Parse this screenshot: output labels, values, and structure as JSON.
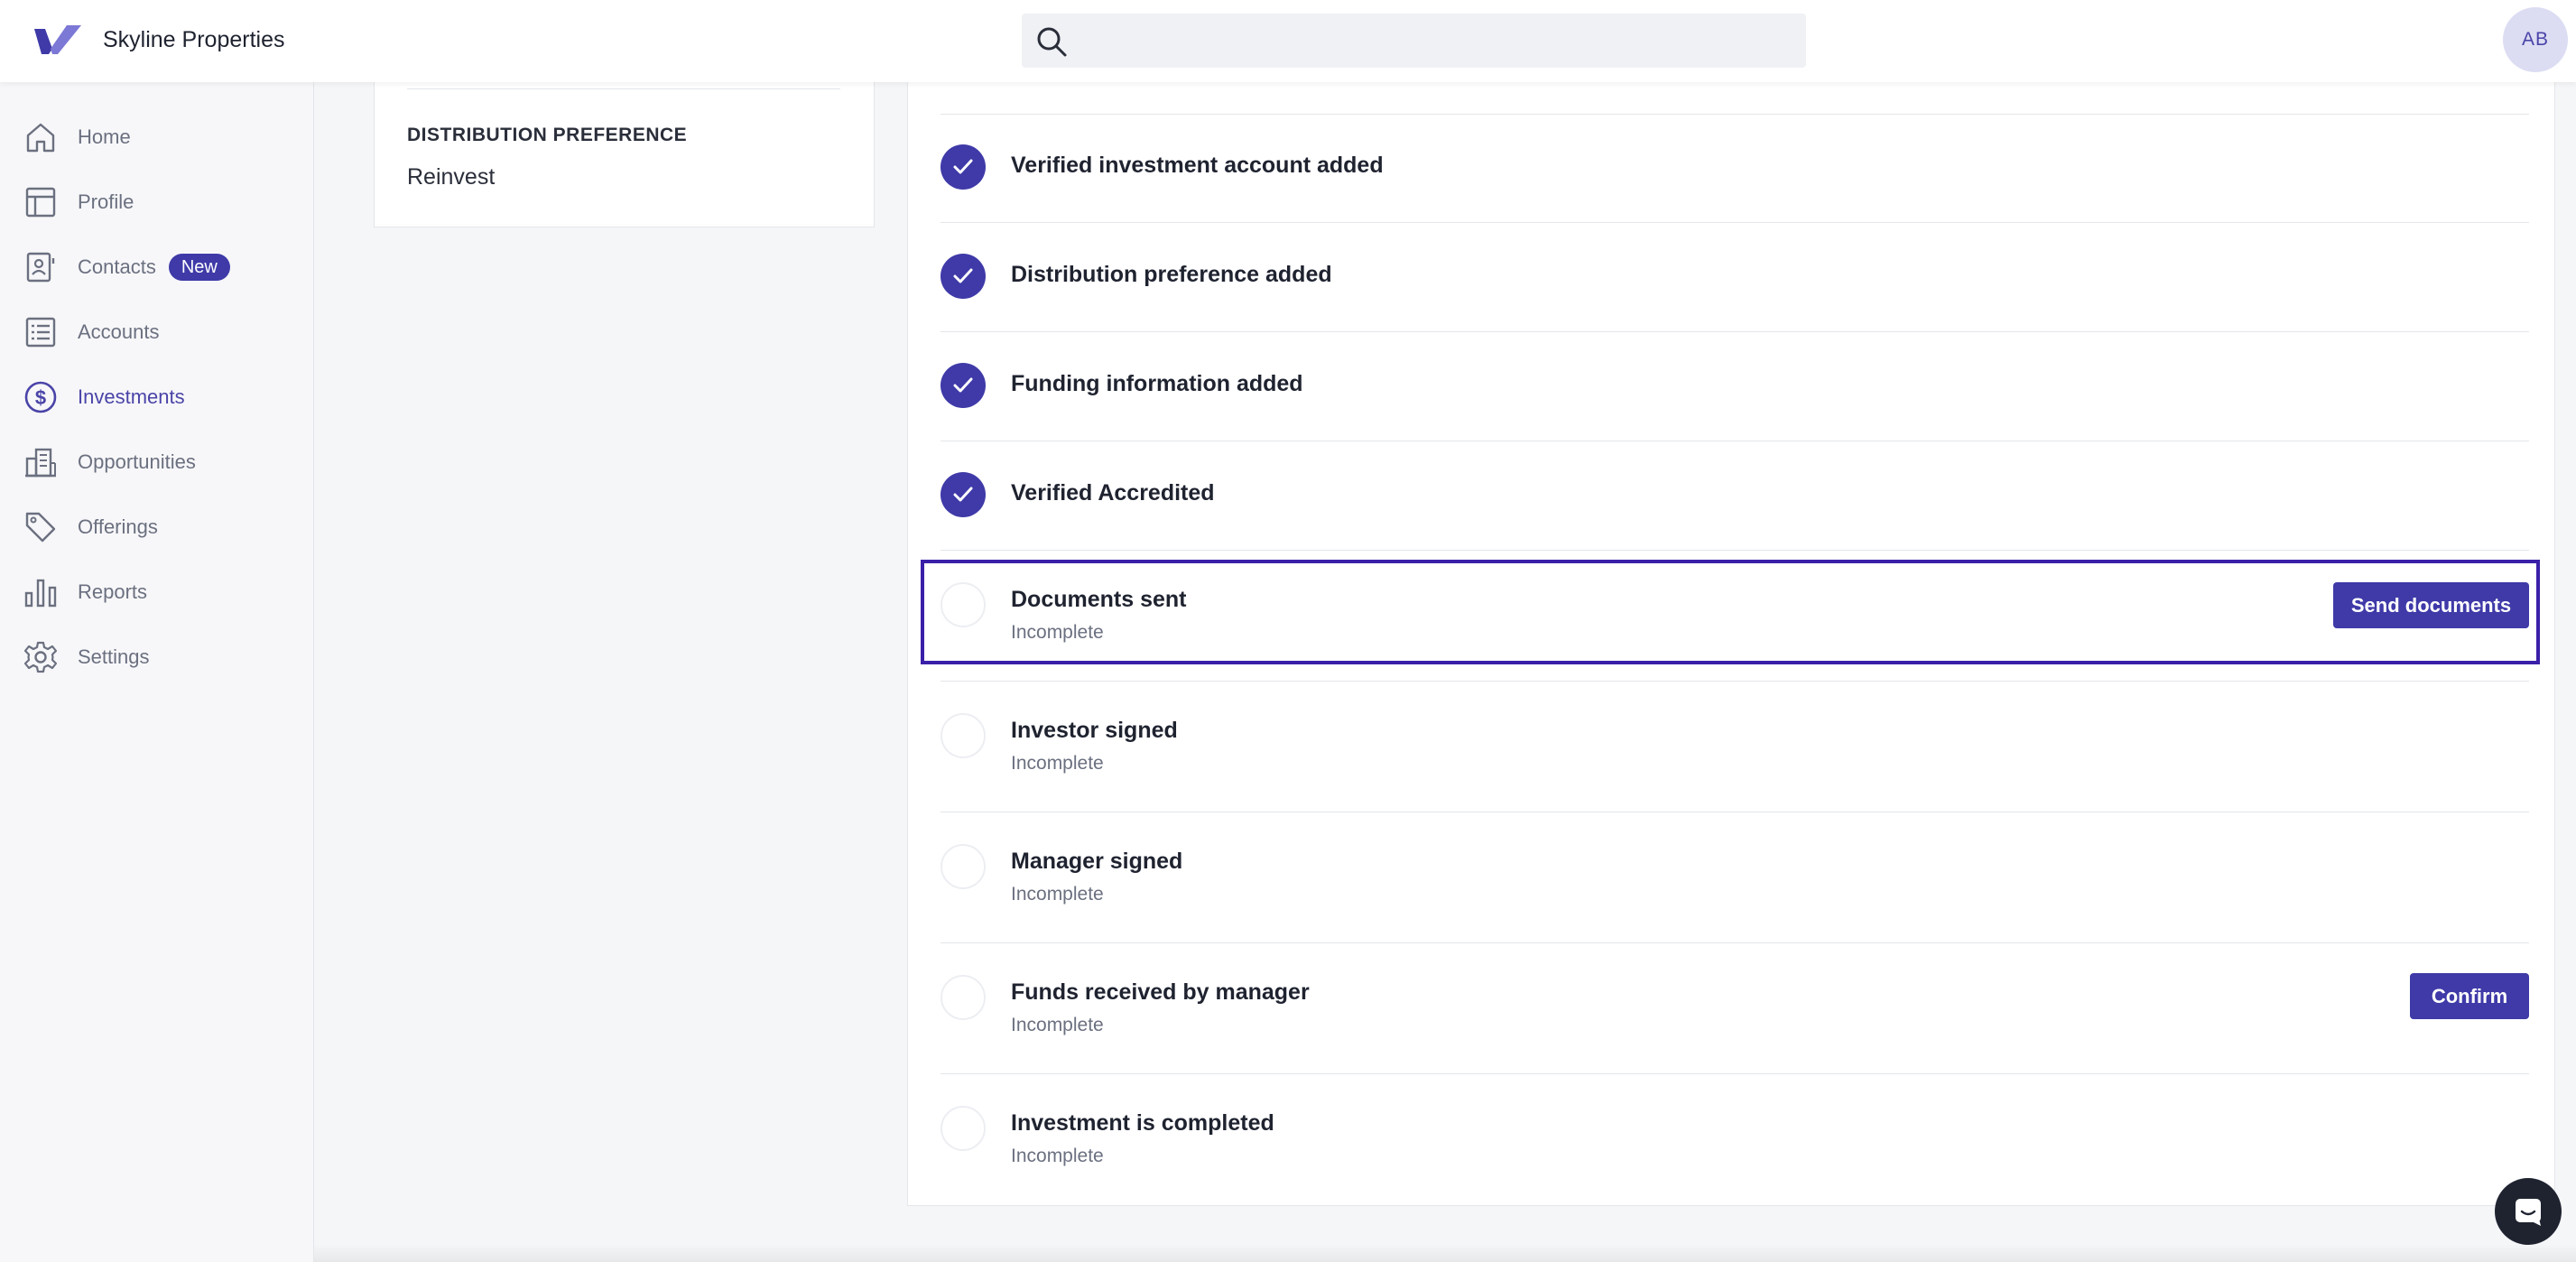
{
  "app": {
    "brand_name": "Skyline Properties",
    "user_initials": "AB",
    "accent_color": "#3f3aa8"
  },
  "search": {
    "placeholder": "",
    "value": ""
  },
  "sidebar": {
    "items": [
      {
        "label": "Home",
        "icon": "home-icon"
      },
      {
        "label": "Profile",
        "icon": "layout-icon"
      },
      {
        "label": "Contacts",
        "icon": "contact-card-icon",
        "badge": "New"
      },
      {
        "label": "Accounts",
        "icon": "list-icon"
      },
      {
        "label": "Investments",
        "icon": "dollar-circle-icon",
        "active": true
      },
      {
        "label": "Opportunities",
        "icon": "buildings-icon"
      },
      {
        "label": "Offerings",
        "icon": "tag-icon"
      },
      {
        "label": "Reports",
        "icon": "bar-chart-icon"
      },
      {
        "label": "Settings",
        "icon": "gear-icon"
      }
    ]
  },
  "info_card": {
    "label": "DISTRIBUTION PREFERENCE",
    "value": "Reinvest"
  },
  "checklist": {
    "items": [
      {
        "title": "Verified investment account added",
        "status": "complete"
      },
      {
        "title": "Distribution preference added",
        "status": "complete"
      },
      {
        "title": "Funding information added",
        "status": "complete"
      },
      {
        "title": "Verified Accredited",
        "status": "complete"
      },
      {
        "title": "Documents sent",
        "subtitle": "Incomplete",
        "status": "incomplete",
        "action": "Send documents",
        "highlighted": true
      },
      {
        "title": "Investor signed",
        "subtitle": "Incomplete",
        "status": "incomplete"
      },
      {
        "title": "Manager signed",
        "subtitle": "Incomplete",
        "status": "incomplete"
      },
      {
        "title": "Funds received by manager",
        "subtitle": "Incomplete",
        "status": "incomplete",
        "action": "Confirm"
      },
      {
        "title": "Investment is completed",
        "subtitle": "Incomplete",
        "status": "incomplete"
      }
    ]
  }
}
